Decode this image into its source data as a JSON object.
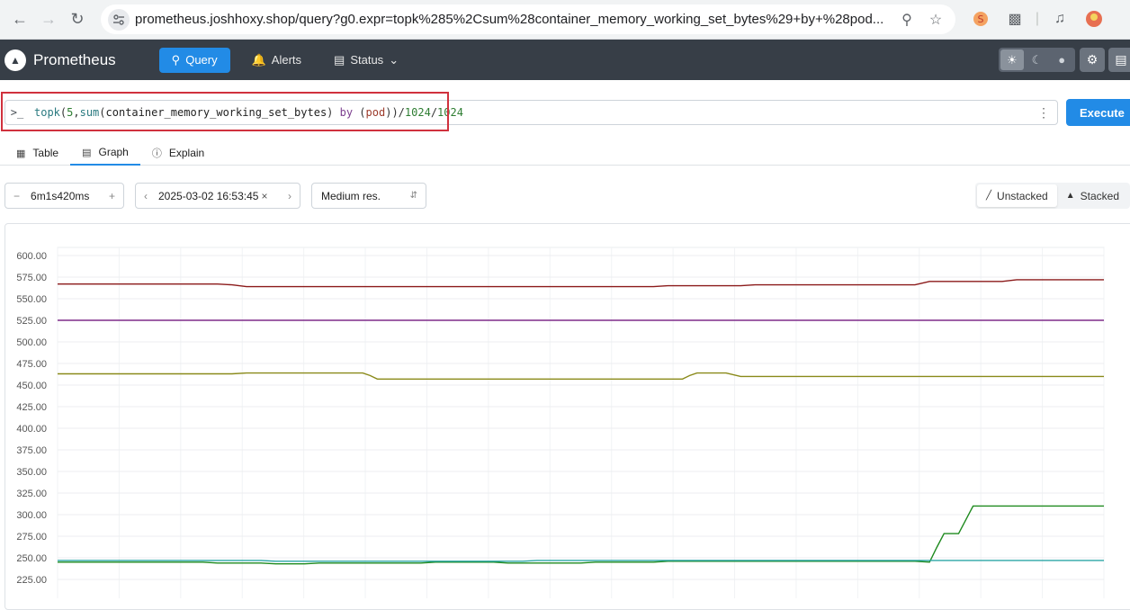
{
  "browser": {
    "url": "prometheus.joshhoxy.shop/query?g0.expr=topk%285%2Csum%28container_memory_working_set_bytes%29+by+%28pod..."
  },
  "app": {
    "name": "Prometheus",
    "nav": {
      "query": "Query",
      "alerts": "Alerts",
      "status": "Status"
    }
  },
  "query": {
    "tokens": [
      {
        "text": "topk",
        "cls": "tok-fn"
      },
      {
        "text": "(",
        "cls": "tok-paren"
      },
      {
        "text": "5",
        "cls": "tok-num"
      },
      {
        "text": ",",
        "cls": "tok-paren"
      },
      {
        "text": "sum",
        "cls": "tok-fn"
      },
      {
        "text": "(",
        "cls": "tok-paren"
      },
      {
        "text": "container_memory_working_set_bytes",
        "cls": "tok-metric"
      },
      {
        "text": ") ",
        "cls": "tok-paren"
      },
      {
        "text": "by",
        "cls": "tok-kw"
      },
      {
        "text": " (",
        "cls": "tok-paren"
      },
      {
        "text": "pod",
        "cls": "tok-label"
      },
      {
        "text": "))/",
        "cls": "tok-paren"
      },
      {
        "text": "1024",
        "cls": "tok-num"
      },
      {
        "text": "/",
        "cls": "tok-paren"
      },
      {
        "text": "1024",
        "cls": "tok-num"
      }
    ],
    "execute_label": "Execute"
  },
  "tabs": {
    "table": "Table",
    "graph": "Graph",
    "explain": "Explain"
  },
  "controls": {
    "range": "6m1s420ms",
    "end_time": "2025-03-02 16:53:45",
    "resolution": "Medium res.",
    "unstacked": "Unstacked",
    "stacked": "Stacked"
  },
  "chart_data": {
    "type": "line",
    "y_ticks": [
      "600.00",
      "575.00",
      "550.00",
      "525.00",
      "500.00",
      "475.00",
      "450.00",
      "425.00",
      "400.00",
      "375.00",
      "350.00",
      "325.00",
      "300.00",
      "275.00",
      "250.00",
      "225.00"
    ],
    "ylim": [
      215,
      610
    ],
    "x_steps": 72,
    "grid": true,
    "series": [
      {
        "color": "#8b1a1a",
        "points": [
          [
            0,
            567
          ],
          [
            11,
            567
          ],
          [
            12,
            566
          ],
          [
            13,
            564
          ],
          [
            41,
            564
          ],
          [
            42,
            565
          ],
          [
            47,
            565
          ],
          [
            48,
            566
          ],
          [
            59,
            566
          ],
          [
            60,
            570
          ],
          [
            65,
            570
          ],
          [
            66,
            572
          ],
          [
            72,
            572
          ]
        ]
      },
      {
        "color": "#7e2c8a",
        "points": [
          [
            0,
            525
          ],
          [
            72,
            525
          ]
        ]
      },
      {
        "color": "#8a8a1a",
        "points": [
          [
            0,
            463
          ],
          [
            12,
            463
          ],
          [
            13,
            464
          ],
          [
            21,
            464
          ],
          [
            21.5,
            461
          ],
          [
            22,
            457
          ],
          [
            43,
            457
          ],
          [
            43.5,
            461
          ],
          [
            44,
            464
          ],
          [
            46,
            464
          ],
          [
            47,
            460
          ],
          [
            72,
            460
          ]
        ]
      },
      {
        "color": "#1e8a1e",
        "points": [
          [
            0,
            245
          ],
          [
            10,
            245
          ],
          [
            11,
            244
          ],
          [
            14,
            244
          ],
          [
            15,
            243
          ],
          [
            17,
            243
          ],
          [
            18,
            244
          ],
          [
            25,
            244
          ],
          [
            26,
            245
          ],
          [
            30,
            245
          ],
          [
            31,
            244
          ],
          [
            36,
            244
          ],
          [
            37,
            245
          ],
          [
            41,
            245
          ],
          [
            42,
            246
          ],
          [
            59,
            246
          ],
          [
            60,
            245
          ],
          [
            60.5,
            262
          ],
          [
            61,
            278
          ],
          [
            62,
            278
          ],
          [
            62.5,
            294
          ],
          [
            63,
            310
          ],
          [
            72,
            310
          ]
        ]
      },
      {
        "color": "#2aa5a5",
        "points": [
          [
            0,
            247
          ],
          [
            14,
            247
          ],
          [
            15,
            246
          ],
          [
            32,
            246
          ],
          [
            33,
            247
          ],
          [
            72,
            247
          ]
        ]
      }
    ]
  }
}
